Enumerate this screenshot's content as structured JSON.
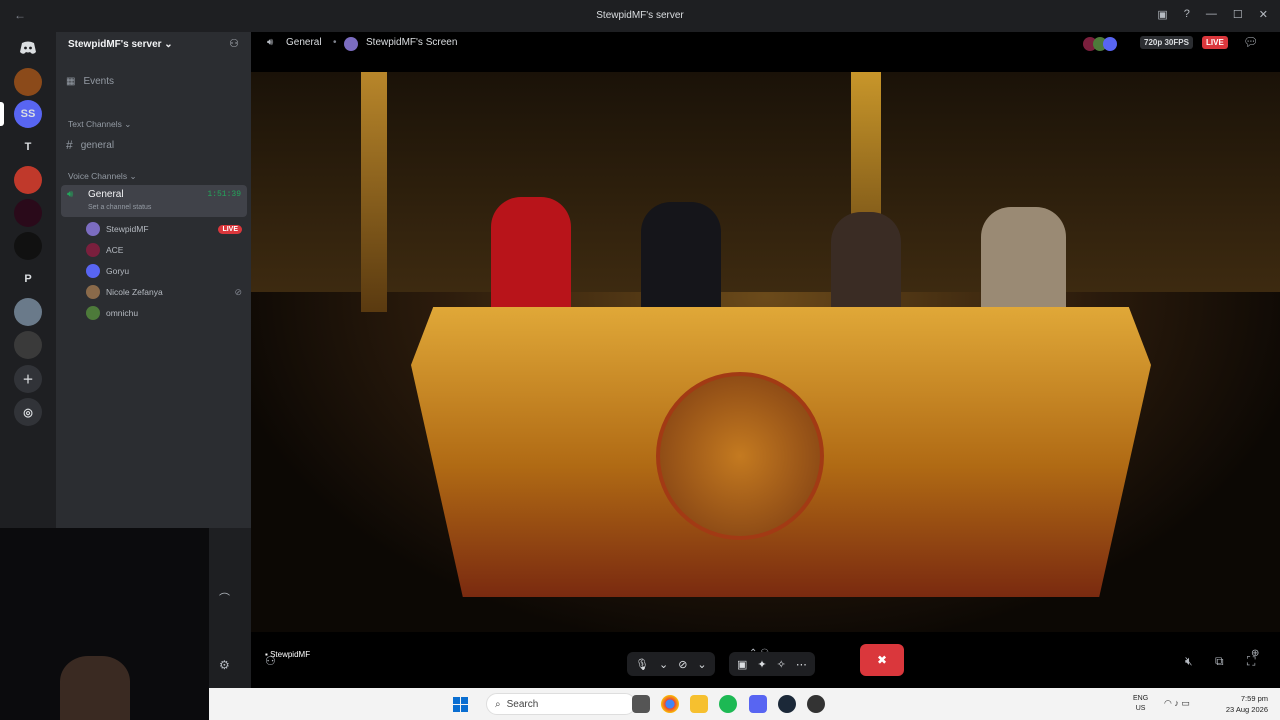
{
  "window": {
    "title": "StewpidMF's server",
    "back_glyph": "←",
    "minimize_glyph": "—",
    "maximize_glyph": "☐",
    "close_glyph": "✕"
  },
  "servers": [
    {
      "label": "SS",
      "color": "#5865f2"
    },
    {
      "label": "T",
      "color": "#313338"
    },
    {
      "label": "P",
      "color": "#313338"
    }
  ],
  "server": {
    "name": "StewpidMF's server",
    "events_label": "Events",
    "text_category": "Text Channels",
    "text_channel": "general",
    "voice_category": "Voice Channels",
    "voice_channel": "General",
    "voice_timer": "1:51:39",
    "channel_status": "Set a channel status"
  },
  "voice_users": [
    {
      "name": "StewpidMF",
      "live": "LIVE",
      "color": "#7b6cc0"
    },
    {
      "name": "ACE",
      "live": "",
      "color": "#7a1f3d"
    },
    {
      "name": "Goryu",
      "live": "",
      "color": "#5865f2"
    },
    {
      "name": "Nicole Zefanya",
      "live": "",
      "color": "#8a6a4a"
    },
    {
      "name": "omnichu",
      "live": "",
      "color": "#4d7a3a"
    }
  ],
  "stream_header": {
    "channel": "General",
    "screen": "StewpidMF's Screen",
    "quality": "720p 30FPS",
    "live": "LIVE"
  },
  "stream_footer": {
    "streamer": "StewpidMF"
  },
  "taskbar": {
    "search_placeholder": "Search",
    "lang_line1": "ENG",
    "lang_line2": "US",
    "time": "7:59 pm",
    "date": "23 Aug 2026"
  },
  "colors": {
    "blurple": "#5865f2",
    "danger": "#da373c",
    "online": "#23a55a",
    "sidebar": "#2b2d31",
    "guildbar": "#1e1f22"
  }
}
